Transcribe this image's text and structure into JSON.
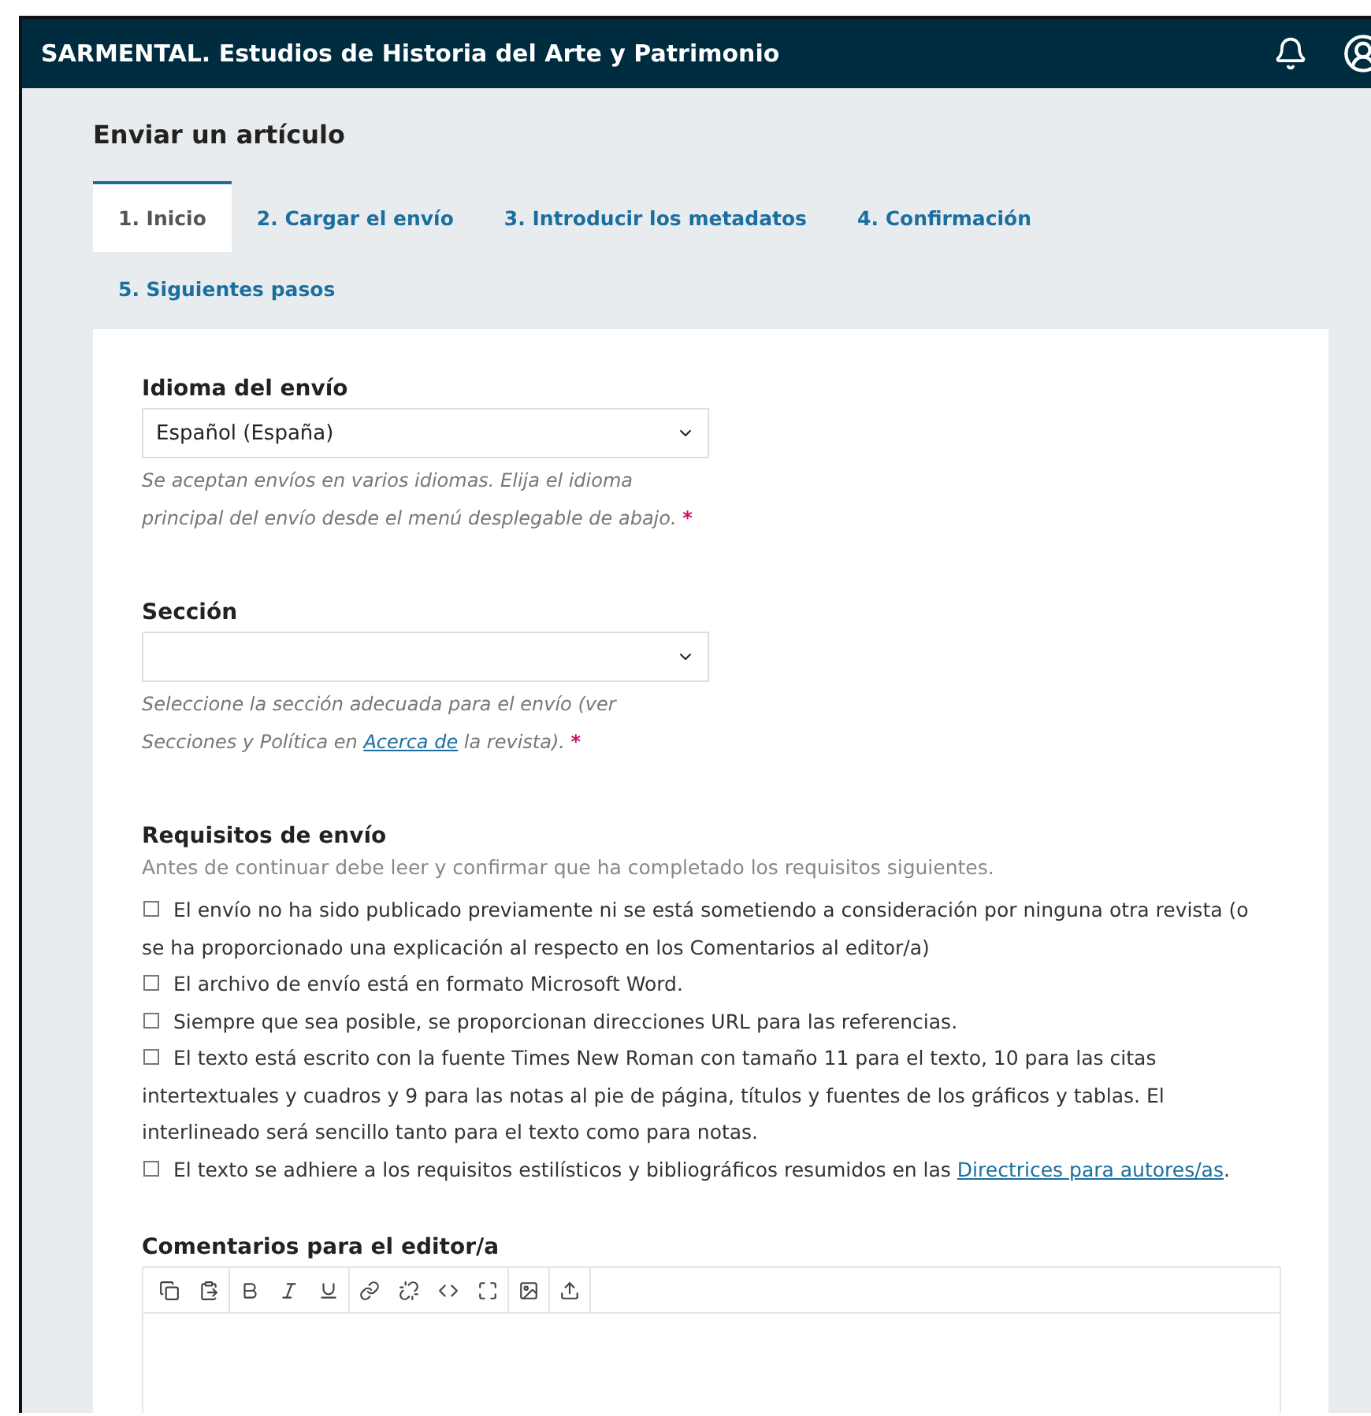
{
  "header": {
    "title": "SARMENTAL. Estudios de Historia del Arte y Patrimonio"
  },
  "page_title": "Enviar un artículo",
  "tabs": [
    {
      "label": "1. Inicio",
      "selected": true
    },
    {
      "label": "2. Cargar el envío",
      "selected": false
    },
    {
      "label": "3. Introducir los metadatos",
      "selected": false
    },
    {
      "label": "4. Confirmación",
      "selected": false
    },
    {
      "label": "5. Siguientes pasos",
      "selected": false
    }
  ],
  "language": {
    "label": "Idioma del envío",
    "value": "Español (España)",
    "help": {
      "before": "Se aceptan envíos en varios idiomas. Elija el idioma principal del envío desde el menú desplegable de abajo.",
      "required_mark": "*"
    }
  },
  "section": {
    "label": "Sección",
    "help": {
      "before": "Seleccione la sección adecuada para el envío (ver Secciones y Política en ",
      "link": "Acerca de",
      "after": " la revista).",
      "required_mark": "*"
    }
  },
  "requirements": {
    "title": "Requisitos de envío",
    "intro": "Antes de continuar debe leer y confirmar que ha completado los requisitos siguientes.",
    "items": [
      {
        "checked": false,
        "text": "El envío no ha sido publicado previamente ni se está sometiendo a consideración por ninguna otra revista (o se ha proporcionado una explicación al respecto en los Comentarios al editor/a)"
      },
      {
        "checked": false,
        "text": "El archivo de envío está en formato Microsoft Word."
      },
      {
        "checked": false,
        "text": "Siempre que sea posible, se proporcionan direcciones URL para las referencias."
      },
      {
        "checked": false,
        "text": "El texto está escrito con la fuente Times New Roman con tamaño 11 para el texto, 10 para las citas intertextuales y cuadros y 9 para las notas al pie de página, títulos y fuentes de los gráficos y tablas. El interlineado será sencillo tanto para el texto como para notas."
      },
      {
        "checked": false,
        "text": "El texto se adhiere a los requisitos estilísticos y bibliográficos resumidos en las ",
        "link": "Directrices para autores/as",
        "after": "."
      }
    ]
  },
  "comments": {
    "label": "Comentarios para el editor/a"
  }
}
